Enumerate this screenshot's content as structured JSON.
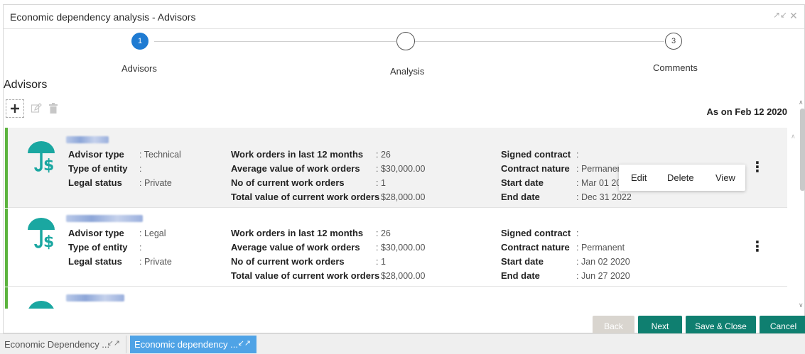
{
  "window": {
    "title": "Economic dependency analysis - Advisors",
    "minimize_icon": "collapse-arrows-icon",
    "close_icon": "close-icon"
  },
  "stepper": {
    "steps": [
      {
        "number": "1",
        "label": "Advisors",
        "state": "active"
      },
      {
        "number": "",
        "label": "Analysis",
        "state": "current"
      },
      {
        "number": "3",
        "label": "Comments",
        "state": "pending"
      }
    ]
  },
  "section": {
    "title": "Advisors",
    "as_on": "As on Feb 12 2020"
  },
  "toolbar": {
    "add_icon": "plus-icon",
    "edit_icon": "edit-icon",
    "delete_icon": "trash-icon"
  },
  "labels": {
    "advisor_type": "Advisor type",
    "type_of_entity": "Type of entity",
    "legal_status": "Legal status",
    "work_orders": "Work orders in last 12 months",
    "avg_value": "Average value of work orders",
    "current_orders": "No of current work orders",
    "total_value": "Total value of current work orders",
    "signed_contract": "Signed contract",
    "contract_nature": "Contract nature",
    "start_date": "Start date",
    "end_date": "End date"
  },
  "advisors": [
    {
      "advisor_type": ": Technical",
      "type_of_entity": ":",
      "legal_status": ": Private",
      "work_orders": ": 26",
      "avg_value": ": $30,000.00",
      "current_orders": ": 1",
      "total_value": ": $28,000.00",
      "signed_contract": ":",
      "contract_nature": ": Permanen",
      "start_date": ": Mar 01 20",
      "end_date": ": Dec 31 2022"
    },
    {
      "advisor_type": ": Legal",
      "type_of_entity": ":",
      "legal_status": ": Private",
      "work_orders": ": 26",
      "avg_value": ": $30,000.00",
      "current_orders": ": 1",
      "total_value": ": $28,000.00",
      "signed_contract": ":",
      "contract_nature": ": Permanent",
      "start_date": ": Jan 02 2020",
      "end_date": ": Jun 27 2020"
    }
  ],
  "context_menu": {
    "edit": "Edit",
    "delete": "Delete",
    "view": "View"
  },
  "footer": {
    "back": "Back",
    "next": "Next",
    "save_close": "Save & Close",
    "cancel": "Cancel"
  },
  "taskbar": {
    "items": [
      {
        "label": "Economic Dependency ...",
        "active": false
      },
      {
        "label": "Economic dependency ...",
        "active": true
      }
    ]
  },
  "colors": {
    "accent_green": "#5cb33e",
    "button_teal": "#0f7f70",
    "step_blue": "#1f7bd2",
    "avatar_teal": "#1aa7a1"
  }
}
